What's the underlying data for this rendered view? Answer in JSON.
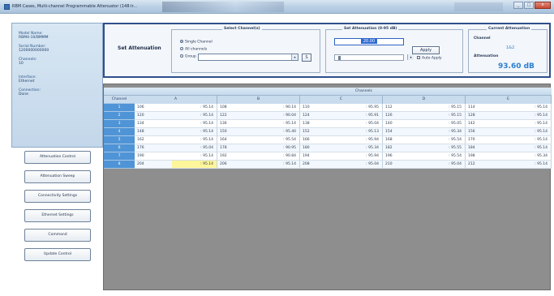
{
  "window": {
    "title": "RBM Cases, Multi-channel Programmable Attenuator (148-Ir...",
    "buttons": [
      "_",
      "□",
      "x"
    ]
  },
  "info_panel": {
    "items": [
      {
        "label": "Model Name:",
        "value": "RBM4-10/BMMM"
      },
      {
        "label": "Serial Number:",
        "value": "1200000000000"
      },
      {
        "label": "Channels:",
        "value": "10"
      },
      {
        "label": "Interface:",
        "value": "Ethernet"
      },
      {
        "label": "Connection:",
        "value": "Done"
      }
    ]
  },
  "left_buttons": [
    "Attenuation Control",
    "Attenuation Sweep",
    "Connectivity Settings",
    "Ethernet Settings",
    "Command",
    "Update Control"
  ],
  "control": {
    "set_attenuation_label": "Set Attenuation",
    "select_channels_title": "Select Channel(s)",
    "radio_single": "Single Channel",
    "radio_all": "All channels",
    "radio_group": "Group",
    "group_button": "S",
    "set_att_title": "Set Attenuation (0-95 dB)",
    "att_value": "20.00",
    "apply_label": "Apply",
    "auto_apply_label": "Auto Apply",
    "current_title": "Current Attenuation",
    "channel_label": "Channel",
    "channel_value": "1&2",
    "attenuation_label": "Attenuation",
    "attenuation_value": "93.60 dB"
  },
  "table": {
    "group_header": "Channels",
    "row_header_title": "Channel",
    "column_headers": [
      "A",
      "B",
      "C",
      "D",
      "E"
    ],
    "row_labels": [
      "1",
      "2",
      "3",
      "4",
      "5",
      "6",
      "7",
      "8"
    ],
    "rows": [
      [
        [
          "106",
          "95.14"
        ],
        [
          "108",
          "90.14"
        ],
        [
          "110",
          "95.95"
        ],
        [
          "112",
          "95.15"
        ],
        [
          "114",
          "95.14"
        ]
      ],
      [
        [
          "120",
          "95.14"
        ],
        [
          "122",
          "90.04"
        ],
        [
          "124",
          "95.91"
        ],
        [
          "126",
          "95.15"
        ],
        [
          "128",
          "95.14"
        ]
      ],
      [
        [
          "134",
          "95.14"
        ],
        [
          "136",
          "95.14"
        ],
        [
          "138",
          "95.04"
        ],
        [
          "140",
          "95.05"
        ],
        [
          "142",
          "95.14"
        ]
      ],
      [
        [
          "148",
          "95.14"
        ],
        [
          "150",
          "95.40"
        ],
        [
          "152",
          "95.13"
        ],
        [
          "154",
          "95.34"
        ],
        [
          "156",
          "95.14"
        ]
      ],
      [
        [
          "162",
          "95.14"
        ],
        [
          "164",
          "95.54"
        ],
        [
          "166",
          "95.94"
        ],
        [
          "168",
          "95.54"
        ],
        [
          "170",
          "95.14"
        ]
      ],
      [
        [
          "176",
          "95.04"
        ],
        [
          "178",
          "90.95"
        ],
        [
          "180",
          "95.34"
        ],
        [
          "182",
          "95.55"
        ],
        [
          "184",
          "95.14"
        ]
      ],
      [
        [
          "190",
          "95.14"
        ],
        [
          "192",
          "90.84"
        ],
        [
          "194",
          "95.94"
        ],
        [
          "196",
          "95.54"
        ],
        [
          "198",
          "95.34"
        ]
      ],
      [
        [
          "204",
          "95.14"
        ],
        [
          "206",
          "95.14"
        ],
        [
          "208",
          "95.04"
        ],
        [
          "210",
          "95.04"
        ],
        [
          "212",
          "95.14"
        ]
      ]
    ]
  },
  "colors": {
    "accent": "#2f4f8c",
    "row_header": "#4f94d6",
    "highlight": "#fff59a",
    "value_blue": "#2a7fd0"
  }
}
